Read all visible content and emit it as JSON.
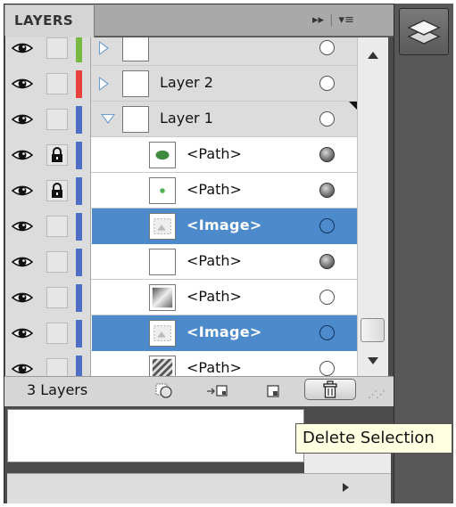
{
  "panel": {
    "tab_label": "LAYERS",
    "header_controls": {
      "collapse_glyph": "▸▸",
      "separator": "|",
      "menu_glyph": "▾≡"
    },
    "layer_count_label": "3 Layers"
  },
  "layers": [
    {
      "name": "",
      "kind": "layer",
      "expanded": false,
      "color": "#77b843",
      "locked": false,
      "target": "empty",
      "selected": false,
      "partially_visible": true
    },
    {
      "name": "Layer 2",
      "kind": "layer",
      "expanded": false,
      "color": "#e8413c",
      "locked": false,
      "target": "empty",
      "selected": false
    },
    {
      "name": "Layer 1",
      "kind": "layer",
      "expanded": true,
      "color": "#4e6fc4",
      "locked": false,
      "target": "empty",
      "selected": false
    },
    {
      "name": "<Path>",
      "kind": "sublayer",
      "thumb": "green-oval-thumb",
      "color": "#4e6fc4",
      "locked": true,
      "target": "filled",
      "selected": false
    },
    {
      "name": "<Path>",
      "kind": "sublayer",
      "thumb": "green-dot-thumb",
      "color": "#4e6fc4",
      "locked": true,
      "target": "filled",
      "selected": false
    },
    {
      "name": "<Image>",
      "kind": "sublayer",
      "thumb": "image-thumb",
      "color": "#4e6fc4",
      "locked": false,
      "target": "blue",
      "selected": true
    },
    {
      "name": "<Path>",
      "kind": "sublayer",
      "thumb": "blank-thumb",
      "color": "#4e6fc4",
      "locked": false,
      "target": "filled",
      "selected": false
    },
    {
      "name": "<Path>",
      "kind": "sublayer",
      "thumb": "gradient-thumb",
      "color": "#4e6fc4",
      "locked": false,
      "target": "empty",
      "selected": false
    },
    {
      "name": "<Image>",
      "kind": "sublayer",
      "thumb": "image-thumb",
      "color": "#4e6fc4",
      "locked": false,
      "target": "blue",
      "selected": true
    },
    {
      "name": "<Path>",
      "kind": "sublayer",
      "thumb": "stripes-thumb",
      "color": "#4e6fc4",
      "locked": false,
      "target": "empty",
      "selected": false
    }
  ],
  "footer_buttons": [
    {
      "name": "make-clipping-mask-button",
      "icon": "clipping-mask-icon"
    },
    {
      "name": "create-new-sublayer-button",
      "icon": "new-sublayer-icon"
    },
    {
      "name": "create-new-layer-button",
      "icon": "new-layer-icon"
    },
    {
      "name": "delete-selection-button",
      "icon": "trash-icon"
    }
  ],
  "tooltip": {
    "text": "Delete Selection"
  },
  "colors": {
    "selection": "#4d8acb",
    "panel_dark": "#4b4b4b",
    "tooltip_bg": "#ffffe1"
  }
}
